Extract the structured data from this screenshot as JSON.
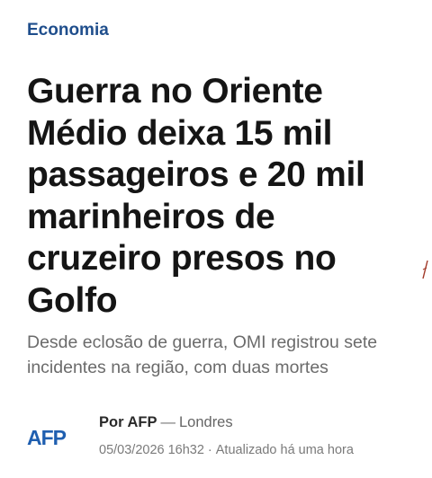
{
  "section": "Economia",
  "headline": "Guerra no Oriente Médio deixa 15 mil passageiros e 20 mil marinheiros de cruzeiro presos no Golfo",
  "subtitle": "Desde eclosão de guerra, OMI registrou sete incidentes na região, com duas mortes",
  "byline": {
    "author": "Por AFP",
    "separator": "—",
    "location": "Londres",
    "published": "05/03/2026 16h32",
    "dot": "·",
    "updated": "Atualizado há uma hora",
    "logo_text": "AFP"
  },
  "colors": {
    "section": "#1f4e8c",
    "logo": "#1f5fb0"
  }
}
